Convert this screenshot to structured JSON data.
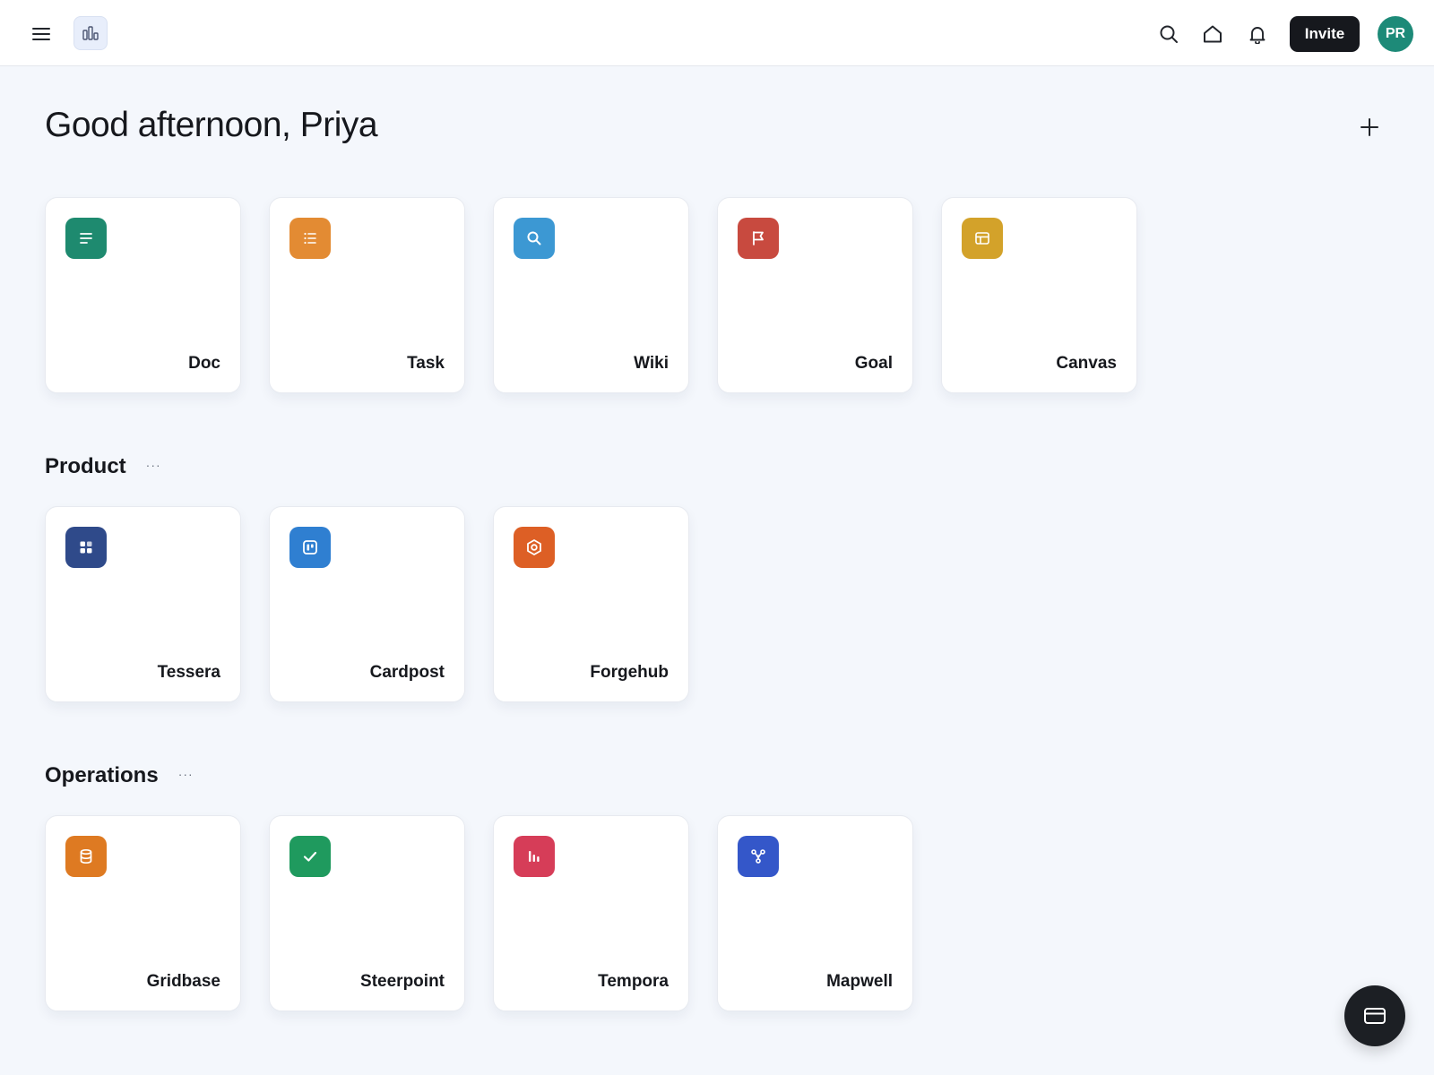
{
  "header": {
    "menu_icon": "hamburger-menu-icon",
    "logo_icon": "bar-chart-logo-icon",
    "actions": [
      {
        "name": "search",
        "icon": "search-icon"
      },
      {
        "name": "home",
        "icon": "home-icon"
      },
      {
        "name": "notifications",
        "icon": "bell-icon"
      }
    ],
    "invite_label": "Invite",
    "avatar_initials": "PR",
    "avatar_color": "#1d8a78"
  },
  "greeting": "Good afternoon, Priya",
  "create_icon": "plus-icon",
  "quick_create": [
    {
      "label": "Doc",
      "icon": "doc-lines-icon",
      "color": "#1e8a6f"
    },
    {
      "label": "Task",
      "icon": "list-icon",
      "color": "#e38b33"
    },
    {
      "label": "Wiki",
      "icon": "search-icon",
      "color": "#3c98d3"
    },
    {
      "label": "Goal",
      "icon": "flag-icon",
      "color": "#c84a3f"
    },
    {
      "label": "Canvas",
      "icon": "layout-icon",
      "color": "#d3a22a"
    }
  ],
  "sections": [
    {
      "title": "Product",
      "more_label": "···",
      "apps": [
        {
          "label": "Tessera",
          "icon": "grid-icon",
          "color": "#2f4a8a"
        },
        {
          "label": "Cardpost",
          "icon": "board-icon",
          "color": "#2f7fd1"
        },
        {
          "label": "Forgehub",
          "icon": "hexagon-icon",
          "color": "#dd5f25"
        }
      ]
    },
    {
      "title": "Operations",
      "more_label": "···",
      "apps": [
        {
          "label": "Gridbase",
          "icon": "database-icon",
          "color": "#de7a22"
        },
        {
          "label": "Steerpoint",
          "icon": "check-icon",
          "color": "#1f9a5e"
        },
        {
          "label": "Tempora",
          "icon": "bar-chart-icon",
          "color": "#d63d58"
        },
        {
          "label": "Mapwell",
          "icon": "network-icon",
          "color": "#3457c9"
        }
      ]
    }
  ],
  "fab_icon": "card-icon"
}
